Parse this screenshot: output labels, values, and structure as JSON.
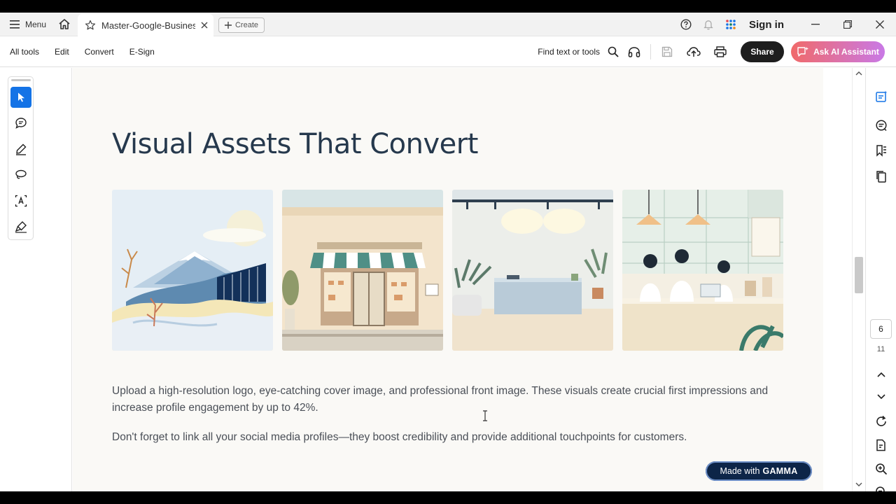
{
  "tabbar": {
    "menu_label": "Menu",
    "tab_title": "Master-Google-Business...",
    "create_label": "Create",
    "sign_in": "Sign in"
  },
  "toolbar": {
    "items": [
      "All tools",
      "Edit",
      "Convert",
      "E-Sign"
    ],
    "find_label": "Find text or tools",
    "share_label": "Share",
    "ai_label": "Ask AI Assistant"
  },
  "document": {
    "title": "Visual Assets That Convert",
    "paragraph1": "Upload a high-resolution logo, eye-catching cover image, and professional front image. These visuals create crucial first impressions and increase profile engagement by up to 42%.",
    "paragraph2": "Don't forget to link all your social media profiles—they boost credibility and provide additional touchpoints for customers.",
    "badge_prefix": "Made with",
    "badge_brand": "GAMMA"
  },
  "pager": {
    "current_page": "6",
    "total_pages": "11"
  },
  "colors": {
    "accent": "#1473e6",
    "title": "#26394d",
    "share_bg": "#1e1e1e",
    "badge_bg": "#0d2548"
  }
}
